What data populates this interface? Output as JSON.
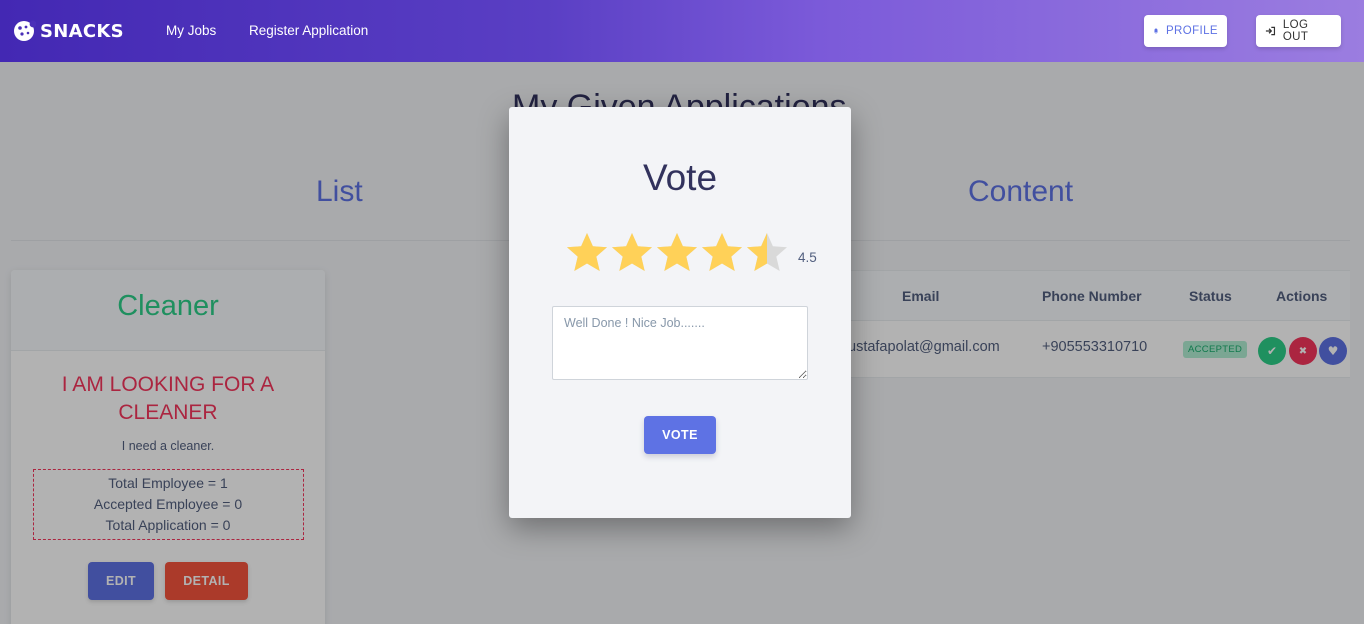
{
  "navbar": {
    "brand": "SNACKS",
    "links": [
      "My Jobs",
      "Register Application"
    ],
    "profile_label": "PROFILE",
    "logout_label": "LOG OUT"
  },
  "page": {
    "title": "My Given Applications",
    "list_heading": "List",
    "content_heading": "Content"
  },
  "card": {
    "category": "Cleaner",
    "title": "I AM LOOKING FOR A CLEANER",
    "description": "I need a cleaner.",
    "stats": [
      "Total Employee = 1",
      "Accepted Employee = 0",
      "Total Application = 0"
    ],
    "edit_label": "EDIT",
    "detail_label": "DETAIL"
  },
  "table": {
    "headers": [
      "Email",
      "Phone Number",
      "Status",
      "Actions"
    ],
    "rows": [
      {
        "email": "ustafapolat@gmail.com",
        "phone": "+905553310710",
        "status": "ACCEPTED"
      }
    ]
  },
  "modal": {
    "title": "Vote",
    "rating": 4.5,
    "rating_text": "4.5",
    "max_rating": 5,
    "comment": "Well Done ! Nice Job.......",
    "vote_label": "VOTE"
  },
  "colors": {
    "primary": "#5e72e4",
    "success": "#2dce89",
    "danger": "#f5365c",
    "star": "#ffd158"
  }
}
